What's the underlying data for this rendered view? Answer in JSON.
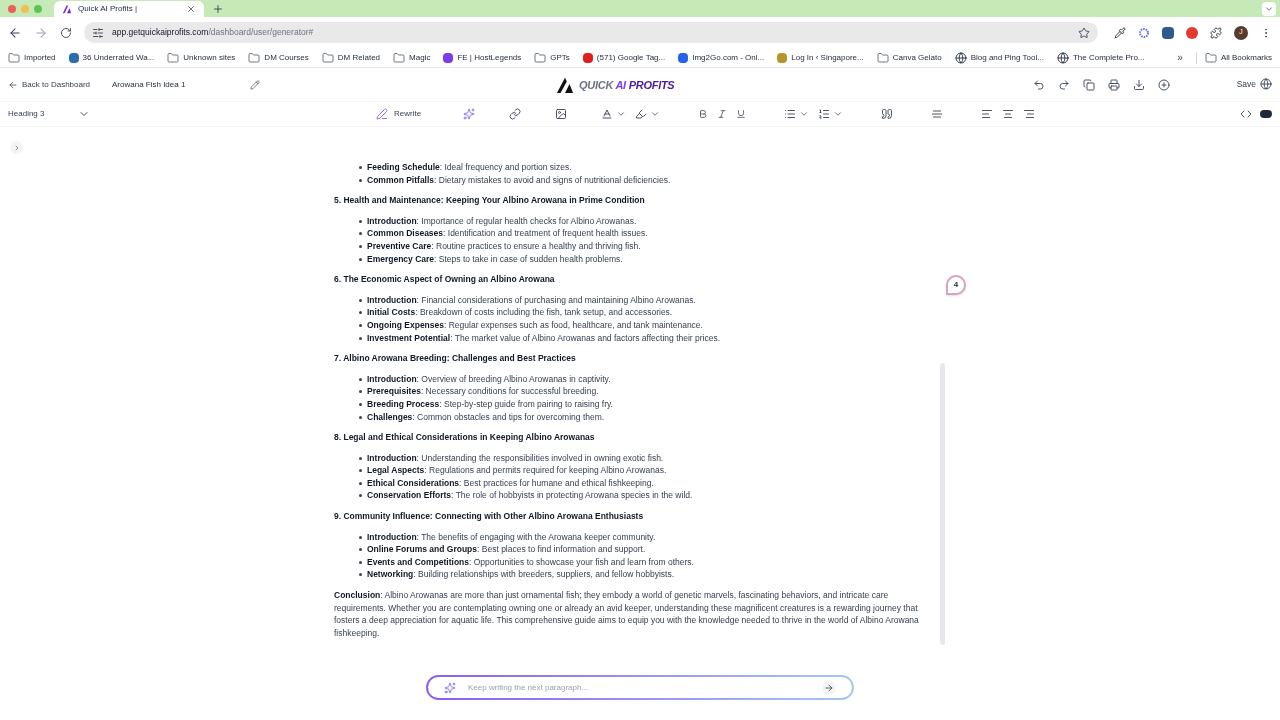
{
  "browser": {
    "tab": {
      "title": "Quick AI Profits |"
    },
    "url": {
      "domain": "app.getquickaiprofits.com",
      "path": "/dashboard/user/generator#"
    },
    "profile": "J",
    "bookmarks": [
      {
        "label": "Imported",
        "kind": "folder"
      },
      {
        "label": "36 Underrated Wa...",
        "kind": "site",
        "color": "#2b6cb0"
      },
      {
        "label": "Unknown sites",
        "kind": "folder"
      },
      {
        "label": "DM Courses",
        "kind": "folder"
      },
      {
        "label": "DM Related",
        "kind": "folder"
      },
      {
        "label": "Magic",
        "kind": "folder"
      },
      {
        "label": "FE | HostLegends",
        "kind": "site",
        "color": "#7c3aed"
      },
      {
        "label": "GPTs",
        "kind": "folder"
      },
      {
        "label": "(571) Google Tag...",
        "kind": "site",
        "color": "#e11d1d"
      },
      {
        "label": "Img2Go.com - Onl...",
        "kind": "site",
        "color": "#2563eb"
      },
      {
        "label": "Log In ‹ Singapore...",
        "kind": "site",
        "color": "#b7952b"
      },
      {
        "label": "Canva Gelato",
        "kind": "folder"
      },
      {
        "label": "Blog and Ping Tool...",
        "kind": "globe"
      },
      {
        "label": "The Complete Pro...",
        "kind": "globe"
      }
    ],
    "more": "»",
    "all_bookmarks": "All Bookmarks"
  },
  "app": {
    "back": "Back to Dashboard",
    "doc_title": "Arowana Fish Idea 1",
    "logo_a": "QUICK",
    "logo_b": "AI",
    "logo_c": "PROFITS",
    "save": "Save",
    "block_type": "Heading 3",
    "rewrite": "Rewrite",
    "comment_count": "4"
  },
  "sections": [
    {
      "items": [
        "**Feeding Schedule**: Ideal frequency and portion sizes.",
        "**Common Pitfalls**: Dietary mistakes to avoid and signs of nutritional deficiencies."
      ]
    },
    {
      "heading": "5. Health and Maintenance: Keeping Your Albino Arowana in Prime Condition",
      "items": [
        "**Introduction**: Importance of regular health checks for Albino Arowanas.",
        "**Common Diseases**: Identification and treatment of frequent health issues.",
        "**Preventive Care**: Routine practices to ensure a healthy and thriving fish.",
        "**Emergency Care**: Steps to take in case of sudden health problems."
      ]
    },
    {
      "heading": "6. The Economic Aspect of Owning an Albino Arowana",
      "items": [
        "**Introduction**: Financial considerations of purchasing and maintaining Albino Arowanas.",
        "**Initial Costs**: Breakdown of costs including the fish, tank setup, and accessories.",
        "**Ongoing Expenses**: Regular expenses such as food, healthcare, and tank maintenance.",
        "**Investment Potential**: The market value of Albino Arowanas and factors affecting their prices."
      ]
    },
    {
      "heading": "7. Albino Arowana Breeding: Challenges and Best Practices",
      "items": [
        "**Introduction**: Overview of breeding Albino Arowanas in captivity.",
        "**Prerequisites**: Necessary conditions for successful breeding.",
        "**Breeding Process**: Step-by-step guide from pairing to raising fry.",
        "**Challenges**: Common obstacles and tips for overcoming them."
      ]
    },
    {
      "heading": "8. Legal and Ethical Considerations in Keeping Albino Arowanas",
      "items": [
        "**Introduction**: Understanding the responsibilities involved in owning exotic fish.",
        "**Legal Aspects**: Regulations and permits required for keeping Albino Arowanas.",
        "**Ethical Considerations**: Best practices for humane and ethical fishkeeping.",
        "**Conservation Efforts**: The role of hobbyists in protecting Arowana species in the wild."
      ]
    },
    {
      "heading": "9. Community Influence: Connecting with Other Albino Arowana Enthusiasts",
      "items": [
        "**Introduction**: The benefits of engaging with the Arowana keeper community.",
        "**Online Forums and Groups**: Best places to find information and support.",
        "**Events and Competitions**: Opportunities to showcase your fish and learn from others.",
        "**Networking**: Building relationships with breeders, suppliers, and fellow hobbyists."
      ]
    }
  ],
  "conclusion": "**Conclusion**: Albino Arowanas are more than just ornamental fish; they embody a world of genetic marvels, fascinating behaviors, and intricate care requirements. Whether you are contemplating owning one or already an avid keeper, understanding these magnificent creatures is a rewarding journey that fosters a deep appreciation for aquatic life. This comprehensive guide aims to equip you with the knowledge needed to thrive in the world of Albino Arowana fishkeeping.",
  "prompt": {
    "placeholder": "Keep writing the next paragraph..."
  }
}
